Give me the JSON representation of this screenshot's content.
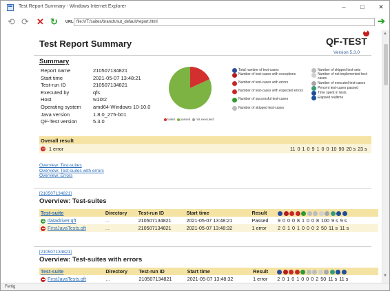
{
  "window": {
    "title": "Test Report Summary - Windows Internet Explorer",
    "minimize": "–",
    "maximize": "□",
    "close": "✕"
  },
  "addressbar": {
    "back": "⟲",
    "forward": "⟳",
    "stop": "✕",
    "refresh": "↻",
    "url_label": "URL:",
    "url": "file:///T:/suites/branch/sut_default/report.html",
    "go": "➔"
  },
  "statusbar": {
    "text": "Fertig"
  },
  "report": {
    "title": "Test Report Summary",
    "logo": "QF-TEST",
    "version": "Version 5.3.0",
    "summary": {
      "heading": "Summary",
      "rows": [
        {
          "key": "Report name",
          "value": "210507134821"
        },
        {
          "key": "Start time",
          "value": "2021-05-07 13:48:21"
        },
        {
          "key": "Test-run ID",
          "value": "210507134821"
        },
        {
          "key": "Executed by",
          "value": "qfs"
        },
        {
          "key": "Host",
          "value": "w10t2"
        },
        {
          "key": "Operating system",
          "value": "amd64-Windows 10-10.0"
        },
        {
          "key": "Java version",
          "value": "1.8.0_275-b01"
        },
        {
          "key": "QF-Test version",
          "value": "5.3.0"
        }
      ]
    },
    "pie": {
      "slices": [
        {
          "label": "failed",
          "value": 2,
          "color": "#d32f2f"
        },
        {
          "label": "passed",
          "value": 9,
          "color": "#7cb342"
        },
        {
          "label": "not executed",
          "value": 0,
          "color": "#9e9e9e"
        }
      ],
      "legend": [
        {
          "label": "failed",
          "color": "#d32f2f"
        },
        {
          "label": "passed",
          "color": "#7cb342"
        },
        {
          "label": "not executed",
          "color": "#9e9e9e"
        }
      ]
    },
    "legend_left": [
      {
        "icon": "total",
        "label": "Total number of test-cases"
      },
      {
        "icon": "exception",
        "label": "Number of test-cases with exceptions"
      },
      {
        "icon": "error",
        "label": "Number of test-cases with errors"
      },
      {
        "icon": "expected-error",
        "label": "Number of test-cases with expected errors"
      },
      {
        "icon": "success",
        "label": "Number of successful test-cases"
      },
      {
        "icon": "skipped-cases",
        "label": "Number of skipped test-cases"
      }
    ],
    "legend_right": [
      {
        "icon": "skipped-sets",
        "label": "Number of skipped test-sets"
      },
      {
        "icon": "not-implemented",
        "label": "Number of not implemented test-cases"
      },
      {
        "icon": "executed",
        "label": "Number of executed test-cases"
      },
      {
        "icon": "percent",
        "label": "Percent test-cases passed"
      },
      {
        "icon": "time",
        "label": "Time spent in tests"
      },
      {
        "icon": "realtime",
        "label": "Elapsed realtime"
      }
    ],
    "overall": {
      "heading": "Overall result",
      "status": "1 error",
      "numbers": [
        "11",
        "0",
        "1",
        "0",
        "9",
        "1",
        "0",
        "0",
        "10",
        "90",
        "20 s",
        "23 s"
      ]
    },
    "toc": [
      "Overview: Test-suites",
      "Overview: Test-suites with errors",
      "Overview: Errors"
    ],
    "suites": {
      "run_link": "[210507134821]",
      "heading": "Overview: Test-suites",
      "columns": [
        "Test-suite",
        "Directory",
        "Test-run ID",
        "Start time",
        "Result"
      ],
      "rows": [
        {
          "icon": "passed",
          "suite": "datadriver.qft",
          "dir": "...",
          "run": "210507134821",
          "start": "2021-05-07 13:48:21",
          "result": "Passed",
          "nums": [
            "9",
            "0",
            "0",
            "0",
            "8",
            "1",
            "0",
            "0",
            "8",
            "100",
            "9 s",
            "9 s"
          ]
        },
        {
          "icon": "error",
          "suite": "FirstJavaTests.qft",
          "dir": "...",
          "run": "210507134821",
          "start": "2021-05-07 13:48:32",
          "result": "1 error",
          "nums": [
            "2",
            "0",
            "1",
            "0",
            "1",
            "0",
            "0",
            "0",
            "2",
            "50",
            "11 s",
            "11 s"
          ]
        }
      ]
    },
    "suites_err": {
      "run_link": "[210507134821]",
      "heading": "Overview: Test-suites with errors",
      "columns": [
        "Test-suite",
        "Directory",
        "Test-run ID",
        "Start time",
        "Result"
      ],
      "rows": [
        {
          "icon": "error",
          "suite": "FirstJavaTests.qft",
          "dir": "...",
          "run": "210507134821",
          "start": "2021-05-07 13:48:32",
          "result": "1 error",
          "nums": [
            "2",
            "0",
            "1",
            "0",
            "1",
            "0",
            "0",
            "0",
            "2",
            "50",
            "11 s",
            "11 s"
          ]
        }
      ]
    }
  }
}
